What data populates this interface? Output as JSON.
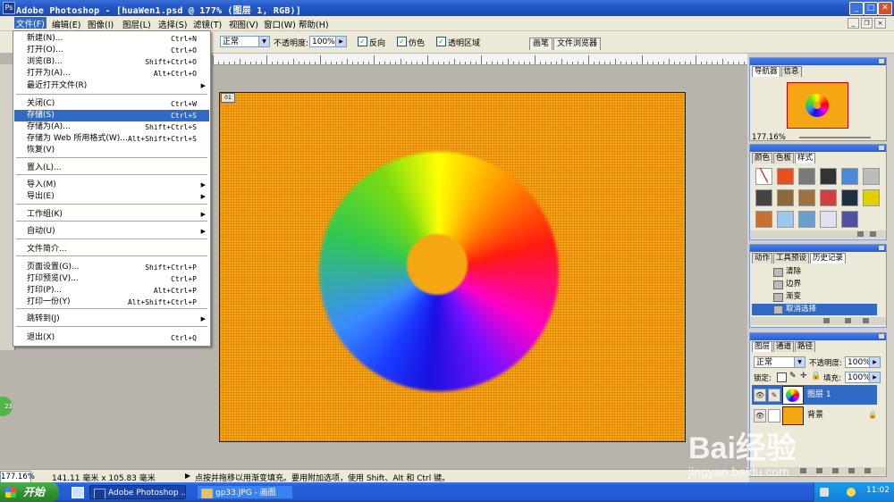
{
  "window": {
    "app_icon": "Ps",
    "title": "Adobe Photoshop - [huaWen1.psd @ 177% (图层 1, RGB)]",
    "controls": {
      "minimize": "_",
      "maximize": "□",
      "close": "✕"
    }
  },
  "menubar": {
    "items": [
      "文件(F)",
      "编辑(E)",
      "图像(I)",
      "图层(L)",
      "选择(S)",
      "滤镜(T)",
      "视图(V)",
      "窗口(W)",
      "帮助(H)"
    ],
    "doc_controls": {
      "minimize": "_",
      "restore": "❐",
      "close": "×"
    }
  },
  "options_bar": {
    "mode": "正常",
    "opacity_label": "不透明度:",
    "opacity_value": "100%",
    "reverse_label": "反向",
    "dither_label": "仿色",
    "transparency_label": "透明区域",
    "palette_well_tabs": [
      "画笔",
      "文件浏览器"
    ]
  },
  "file_menu": {
    "items": [
      {
        "label": "新建(N)...",
        "shortcut": "Ctrl+N"
      },
      {
        "label": "打开(O)...",
        "shortcut": "Ctrl+O"
      },
      {
        "label": "浏览(B)...",
        "shortcut": "Shift+Ctrl+O"
      },
      {
        "label": "打开为(A)...",
        "shortcut": "Alt+Ctrl+O"
      },
      {
        "label": "最近打开文件(R)",
        "shortcut": ""
      },
      {
        "label": "关闭(C)",
        "shortcut": "Ctrl+W"
      },
      {
        "label": "存储(S)",
        "shortcut": "Ctrl+S"
      },
      {
        "label": "存储为(A)...",
        "shortcut": "Shift+Ctrl+S"
      },
      {
        "label": "存储为 Web 所用格式(W)...",
        "shortcut": "Alt+Shift+Ctrl+S"
      },
      {
        "label": "恢复(V)",
        "shortcut": ""
      },
      {
        "label": "置入(L)...",
        "shortcut": ""
      },
      {
        "label": "导入(M)",
        "shortcut": ""
      },
      {
        "label": "导出(E)",
        "shortcut": ""
      },
      {
        "label": "工作组(K)",
        "shortcut": ""
      },
      {
        "label": "自动(U)",
        "shortcut": ""
      },
      {
        "label": "文件简介...",
        "shortcut": ""
      },
      {
        "label": "页面设置(G)...",
        "shortcut": "Shift+Ctrl+P"
      },
      {
        "label": "打印预览(V)...",
        "shortcut": "Ctrl+P"
      },
      {
        "label": "打印(P)...",
        "shortcut": "Alt+Ctrl+P"
      },
      {
        "label": "打印一份(Y)",
        "shortcut": "Alt+Shift+Ctrl+P"
      },
      {
        "label": "跳转到(J)",
        "shortcut": ""
      },
      {
        "label": "退出(X)",
        "shortcut": "Ctrl+Q"
      }
    ],
    "highlighted": "存储(S)",
    "submenu_arrow": "▶"
  },
  "canvas": {
    "doc_tag": "01"
  },
  "status_bar": {
    "zoom": "177.16%",
    "doc_size": "141.11 毫米 x 105.83 毫米",
    "hint": "点按并拖移以用渐变填充。要用附加选项，使用 Shift、Alt 和 Ctrl 键。"
  },
  "navigator": {
    "tabs": [
      "导航器",
      "信息"
    ],
    "zoom": "177.16%"
  },
  "swatches_palette": {
    "tabs": [
      "颜色",
      "色板",
      "样式"
    ]
  },
  "history_palette": {
    "tabs": [
      "动作",
      "工具预设",
      "历史记录"
    ],
    "items": [
      "清除",
      "边界",
      "渐变",
      "取消选择"
    ],
    "selected": "取消选择"
  },
  "layers_palette": {
    "tabs": [
      "图层",
      "通道",
      "路径"
    ],
    "blend_mode": "正常",
    "opacity_label": "不透明度:",
    "opacity_value": "100%",
    "lock_label": "锁定:",
    "fill_label": "填充:",
    "fill_value": "100%",
    "layers": [
      {
        "name": "图层 1",
        "selected": true
      },
      {
        "name": "背景",
        "selected": false
      }
    ]
  },
  "taskbar": {
    "start": "开始",
    "tasks": [
      "Adobe Photoshop ...",
      "gp33.JPG - 画图"
    ],
    "clock": "11:02"
  },
  "watermark": {
    "text": "Bai经验",
    "subtext": "jingyan.baidu.com"
  },
  "colors": {
    "accent": "#316ac5",
    "canvas_orange": "#f5a613",
    "taskbar_blue": "#245edb"
  },
  "icons": [
    "photoshop-app-icon",
    "windows-start-icon",
    "gradient-tool-icon",
    "eye-icon",
    "brush-icon",
    "lock-icon"
  ]
}
